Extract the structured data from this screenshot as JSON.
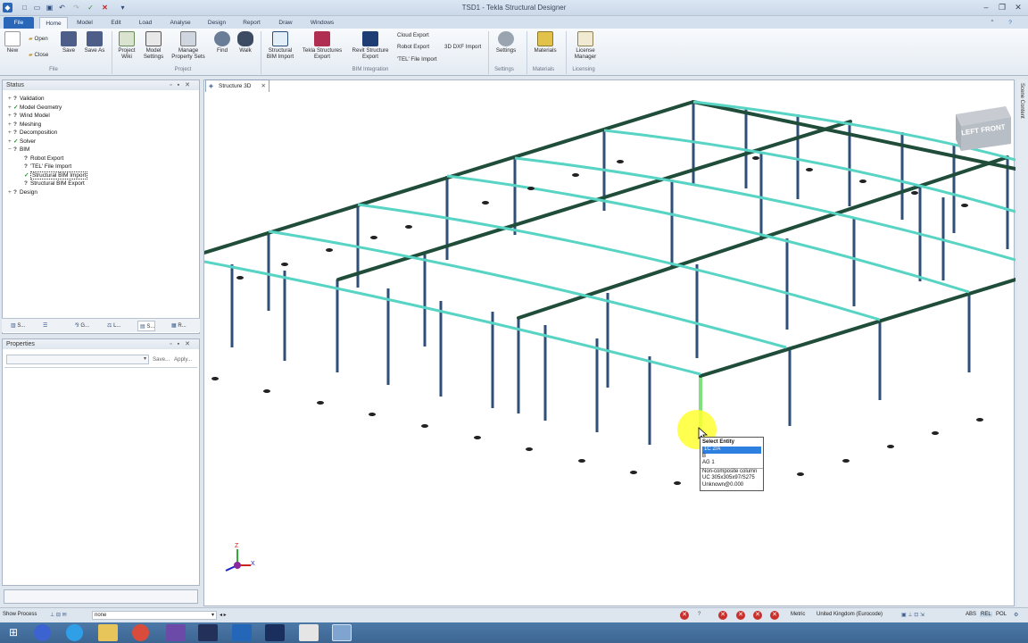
{
  "app": {
    "title": "TSD1 - Tekla Structural Designer"
  },
  "ribbon_tabs": [
    "File",
    "Home",
    "Model",
    "Edit",
    "Load",
    "Analyse",
    "Design",
    "Report",
    "Draw",
    "Windows"
  ],
  "ribbon": {
    "new": "New",
    "open": "Open",
    "close": "Close",
    "save": "Save",
    "save_as": "Save As",
    "project_wiki": "Project Wiki",
    "model_settings": "Model Settings",
    "manage_property_sets": "Manage Property Sets",
    "find": "Find",
    "walk": "Walk",
    "structural_bim_import": "Structural BIM Import",
    "tekla_structures_export": "Tekla Structures Export",
    "revit_structure_export": "Revit Structure Export",
    "cloud_export": "Cloud Export",
    "robot_export": "Robot Export",
    "tel_file_import": "'TEL' File Import",
    "dxf_import": "3D DXF Import",
    "settings": "Settings",
    "materials": "Materials",
    "license_manager": "License Manager",
    "groups": {
      "file": "File",
      "project": "Project",
      "bim": "BIM Integration",
      "settings": "Settings",
      "materials": "Materials",
      "licensing": "Licensing"
    }
  },
  "status_panel": {
    "title": "Status",
    "tree": [
      "Validation",
      "Model Geometry",
      "Wind Model",
      "Meshing",
      "Decomposition",
      "Solver",
      "BIM",
      "Robot Export",
      "'TEL' File Import",
      "Structural BIM Import",
      "Structural BIM Export",
      "Design"
    ],
    "tabs": [
      "S...",
      "",
      "G...",
      "L...",
      "S...",
      "R..."
    ]
  },
  "properties_panel": {
    "title": "Properties",
    "save_label": "Save...",
    "apply_label": "Apply..."
  },
  "view": {
    "tab_label": "Structure 3D",
    "nav_cube": "LEFT FRONT",
    "scene_content": "Scene Content",
    "axis_z": "Z",
    "axis_x": "X"
  },
  "popup": {
    "title": "Select Entity",
    "items": [
      "1C 2/A",
      "B",
      "AG 1"
    ],
    "info": [
      "Non-composite column",
      "UC 305x305x97/S275",
      "Unknown@0.000"
    ]
  },
  "status_bar": {
    "show_process": "Show Process",
    "filter_value": "none",
    "units": "Metric",
    "code": "United Kingdom (Eurocode)",
    "abs": "ABS",
    "rel": "REL",
    "pol": "POL"
  }
}
